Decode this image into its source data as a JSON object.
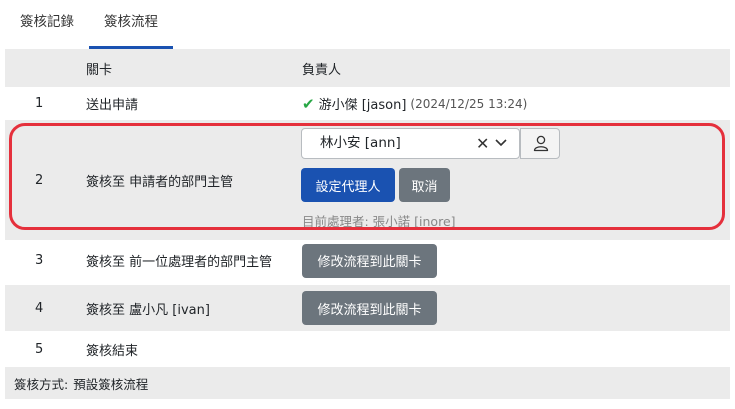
{
  "tabs": [
    {
      "label": "簽核記錄"
    },
    {
      "label": "簽核流程"
    }
  ],
  "table": {
    "headers": {
      "stage": "關卡",
      "owner": "負責人"
    },
    "rows": [
      {
        "num": "1",
        "stage": "送出申請",
        "signer": "游小傑 [jason]",
        "time": "(2024/12/25 13:24)"
      },
      {
        "num": "2",
        "stage": "簽核至 申請者的部門主管"
      },
      {
        "num": "3",
        "stage": "簽核至 前一位處理者的部門主管",
        "button": "修改流程到此關卡"
      },
      {
        "num": "4",
        "stage": "簽核至 盧小凡 [ivan]",
        "button": "修改流程到此關卡"
      },
      {
        "num": "5",
        "stage": "簽核結束"
      }
    ]
  },
  "editor": {
    "selected_value": "林小安 [ann]",
    "set_agent_label": "設定代理人",
    "cancel_label": "取消",
    "current_handler": "目前處理者: 張小諾 [inore]"
  },
  "footer": {
    "label": "簽核方式:",
    "value": "預設簽核流程"
  },
  "colors": {
    "accent": "#1a52b1",
    "highlight": "#e5303c",
    "secondary": "#6c757d",
    "check": "#28a745"
  }
}
